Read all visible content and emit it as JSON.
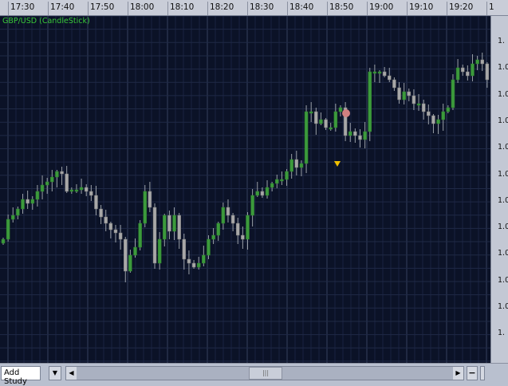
{
  "time_labels": [
    "17:30",
    "17:40",
    "17:50",
    "18:00",
    "18:10",
    "18:20",
    "18:30",
    "18:40",
    "18:50",
    "19:00",
    "19:10",
    "19:20",
    "1"
  ],
  "title": "GBP/USD (CandleStick)",
  "price_labels": [
    "1.",
    "1.0",
    "1.0",
    "1.0",
    "1.0",
    "1.0",
    "1.0",
    "1.0",
    "1.0",
    "1.0",
    "1.0",
    "1."
  ],
  "bottom": {
    "add_study": "Add Study",
    "dropdown": "▼",
    "left": "◀",
    "right": "▶",
    "thumb": "|||",
    "minus": "−"
  },
  "colors": {
    "up": "#3c9a3c",
    "down": "#a8a8a8",
    "background": "#0b1227",
    "grid": "#2a3350"
  },
  "chart_data": {
    "type": "candlestick",
    "symbol": "GBP/USD",
    "interval_minutes": 1,
    "closes_index": [
      200,
      225,
      230,
      238,
      250,
      245,
      250,
      260,
      268,
      272,
      278,
      285,
      282,
      260,
      262,
      262,
      265,
      260,
      255,
      238,
      228,
      220,
      212,
      208,
      200,
      160,
      180,
      190,
      220,
      260,
      240,
      170,
      200,
      230,
      210,
      230,
      200,
      175,
      170,
      165,
      170,
      180,
      200,
      205,
      220,
      240,
      230,
      220,
      205,
      200,
      230,
      255,
      260,
      255,
      265,
      270,
      275,
      275,
      285,
      300,
      290,
      295,
      360,
      360,
      345,
      350,
      340,
      340,
      360,
      365,
      330,
      335,
      330,
      325,
      335,
      410,
      410,
      410,
      405,
      400,
      390,
      375,
      385,
      380,
      370,
      370,
      360,
      355,
      345,
      350,
      360,
      365,
      400,
      415,
      410,
      405,
      420,
      425,
      420,
      400
    ],
    "markers": [
      {
        "type": "buy",
        "shape": "circle",
        "color": "#d08080"
      },
      {
        "type": "sell",
        "shape": "triangle-down",
        "color": "#f0c000"
      }
    ]
  }
}
